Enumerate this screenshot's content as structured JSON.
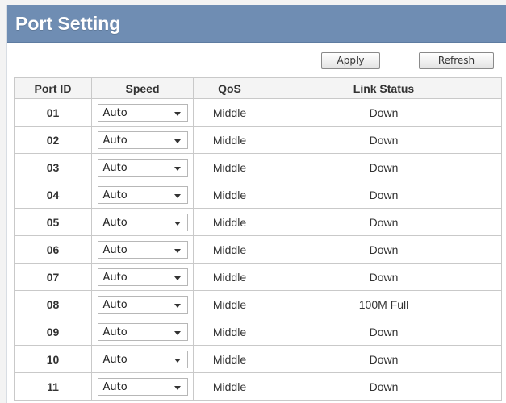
{
  "header": {
    "title": "Port Setting"
  },
  "toolbar": {
    "apply_label": "Apply",
    "refresh_label": "Refresh"
  },
  "table": {
    "columns": [
      "Port ID",
      "Speed",
      "QoS",
      "Link Status"
    ],
    "rows": [
      {
        "port_id": "01",
        "speed": "Auto",
        "qos": "Middle",
        "link_status": "Down"
      },
      {
        "port_id": "02",
        "speed": "Auto",
        "qos": "Middle",
        "link_status": "Down"
      },
      {
        "port_id": "03",
        "speed": "Auto",
        "qos": "Middle",
        "link_status": "Down"
      },
      {
        "port_id": "04",
        "speed": "Auto",
        "qos": "Middle",
        "link_status": "Down"
      },
      {
        "port_id": "05",
        "speed": "Auto",
        "qos": "Middle",
        "link_status": "Down"
      },
      {
        "port_id": "06",
        "speed": "Auto",
        "qos": "Middle",
        "link_status": "Down"
      },
      {
        "port_id": "07",
        "speed": "Auto",
        "qos": "Middle",
        "link_status": "Down"
      },
      {
        "port_id": "08",
        "speed": "Auto",
        "qos": "Middle",
        "link_status": "100M Full"
      },
      {
        "port_id": "09",
        "speed": "Auto",
        "qos": "Middle",
        "link_status": "Down"
      },
      {
        "port_id": "10",
        "speed": "Auto",
        "qos": "Middle",
        "link_status": "Down"
      },
      {
        "port_id": "11",
        "speed": "Auto",
        "qos": "Middle",
        "link_status": "Down"
      }
    ]
  },
  "icons": {
    "dropdown": "chevron-down-icon"
  },
  "colors": {
    "header_bg": "#6f8db3",
    "header_text": "#ffffff",
    "grid_border": "#c9c9c9"
  }
}
